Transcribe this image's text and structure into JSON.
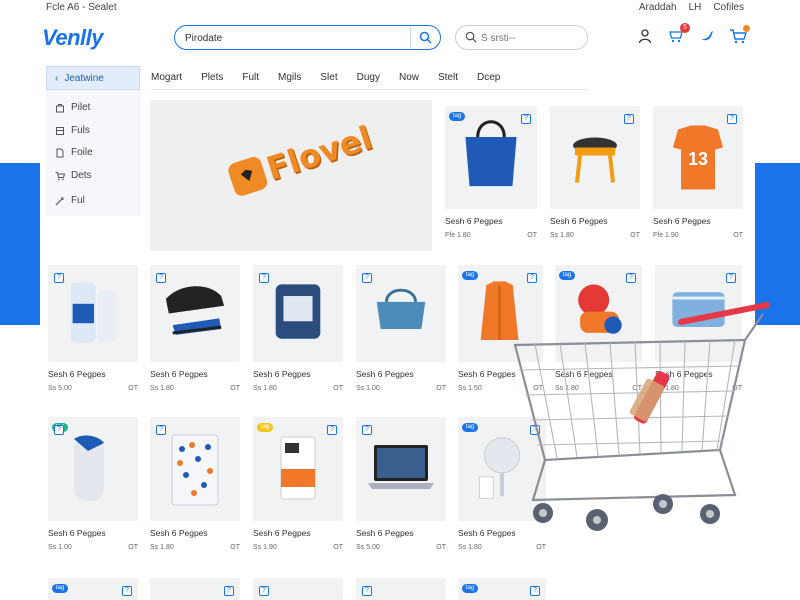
{
  "topbar": {
    "left": "Fcle  A6  -  Sealet",
    "right_items": [
      "Araddah",
      "LH",
      "Cofiles"
    ]
  },
  "brand": {
    "name": "Venlly",
    "color": "#1a73e8"
  },
  "search": {
    "value": "Pirodate",
    "icon": "search-icon"
  },
  "search2": {
    "placeholder": "S srsti--",
    "icon": "search-icon"
  },
  "header_icons": [
    {
      "name": "account-icon"
    },
    {
      "name": "wishlist-icon",
      "badge": "5"
    },
    {
      "name": "social-icon"
    },
    {
      "name": "cart-icon"
    }
  ],
  "sidebar": {
    "header": "Jeatwine",
    "items": [
      {
        "label": "Pilet",
        "icon": "bag-icon"
      },
      {
        "label": "Fuls",
        "icon": "box-icon"
      },
      {
        "label": "Foile",
        "icon": "file-icon"
      },
      {
        "label": "Dets",
        "icon": "cart-icon"
      },
      {
        "label": "Ful",
        "icon": "tag-icon"
      }
    ]
  },
  "categories": [
    "Mogart",
    "Plets",
    "Fult",
    "Mgils",
    "Slet",
    "Dugy",
    "Now",
    "Stelt",
    "Dcep"
  ],
  "hero": {
    "brand_text": "Flovel",
    "color": "#f08a24"
  },
  "product_name": "Sesh 6 Pegpes",
  "price_tail": "OT",
  "products": [
    {
      "price": "Ffe 1.80",
      "tag": "tag",
      "tag_color": "#1a73e8",
      "image": "tote-bag"
    },
    {
      "price": "Ss 1.80",
      "image": "stool"
    },
    {
      "price": "Ffe 1.90",
      "image": "jersey",
      "jersey_number": "13"
    },
    {
      "price": "Ss 5.00",
      "image": "bottles"
    },
    {
      "price": "Ss 1.80",
      "image": "shoe"
    },
    {
      "price": "Ss 1.80",
      "image": "tablet-case"
    },
    {
      "price": "Ss 1.00",
      "image": "handbag"
    },
    {
      "price": "Ss 1.50",
      "tag": "tag",
      "tag_color": "#1a73e8",
      "image": "vest"
    },
    {
      "price": "Ss 1.80",
      "tag": "tag",
      "tag_color": "#1a73e8",
      "image": "toy"
    },
    {
      "price": "Ss 1.80",
      "image": "pouch"
    },
    {
      "price": "Ss 1.00",
      "tag": "tag",
      "tag_color": "#1fb38a",
      "image": "gadget"
    },
    {
      "price": "Ss 1.80",
      "image": "snack-bag"
    },
    {
      "price": "Ss 1.90",
      "tag": "tag",
      "tag_color": "#f5c518",
      "image": "box"
    },
    {
      "price": "Ss 5.00",
      "image": "laptop"
    },
    {
      "price": "Ss 1.80",
      "tag": "tag",
      "tag_color": "#1a73e8",
      "image": "speaker"
    },
    {
      "tag": "tag",
      "tag_color": "#1a73e8",
      "image": "partial"
    },
    {
      "image": "partial"
    },
    {
      "image": "partial"
    },
    {
      "image": "partial"
    },
    {
      "tag": "tag",
      "tag_color": "#1a73e8",
      "image": "partial"
    }
  ]
}
